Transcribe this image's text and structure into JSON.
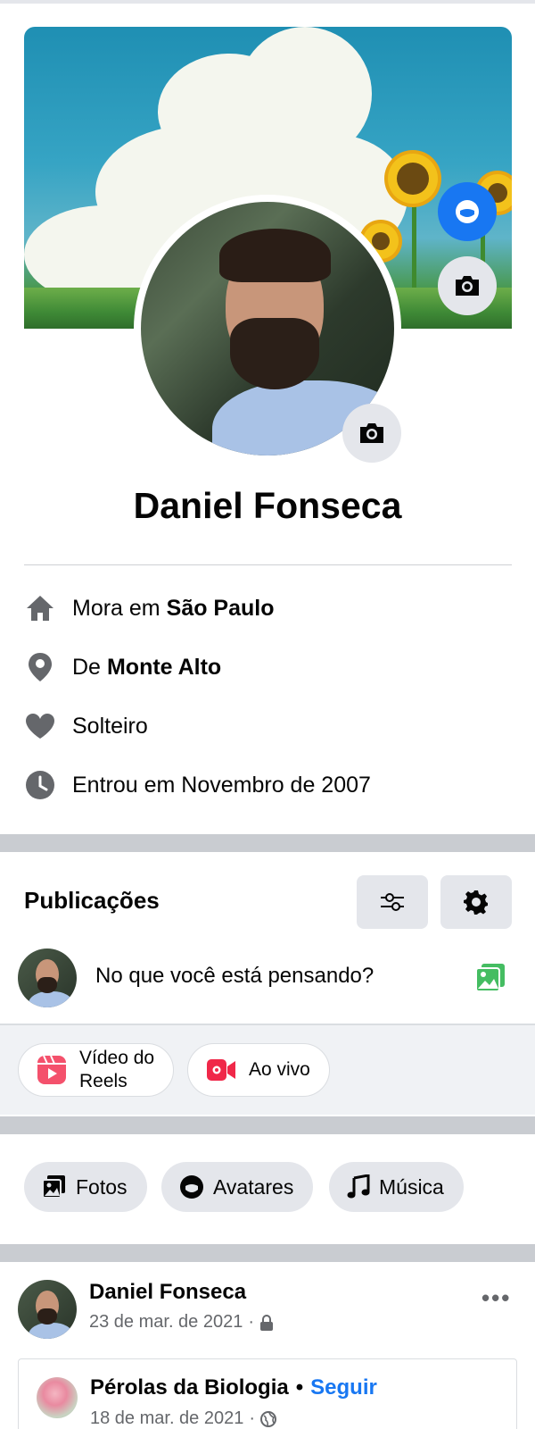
{
  "profile": {
    "name": "Daniel Fonseca"
  },
  "intro": {
    "lives_prefix": "Mora em",
    "lives_city": "São Paulo",
    "from_prefix": "De",
    "from_city": "Monte Alto",
    "relationship": "Solteiro",
    "joined": "Entrou em Novembro de 2007"
  },
  "posts_section": {
    "title": "Publicações",
    "composer_placeholder": "No que você está pensando?",
    "reels_label_line1": "Vídeo do",
    "reels_label_line2": "Reels",
    "live_label": "Ao vivo"
  },
  "chips": {
    "photos": "Fotos",
    "avatars": "Avatares",
    "music": "Música"
  },
  "post": {
    "author": "Daniel Fonseca",
    "date": "23 de mar. de 2021",
    "privacy_icon": "lock-icon",
    "more": "•••",
    "shared": {
      "page": "Pérolas da Biologia",
      "separator": "•",
      "follow": "Seguir",
      "date": "18 de mar. de 2021",
      "privacy_icon": "globe-icon"
    }
  },
  "colors": {
    "accent": "#1877f2",
    "button_bg": "#e4e6eb",
    "separator": "#c9ccd1",
    "muted_text": "#65676b"
  }
}
